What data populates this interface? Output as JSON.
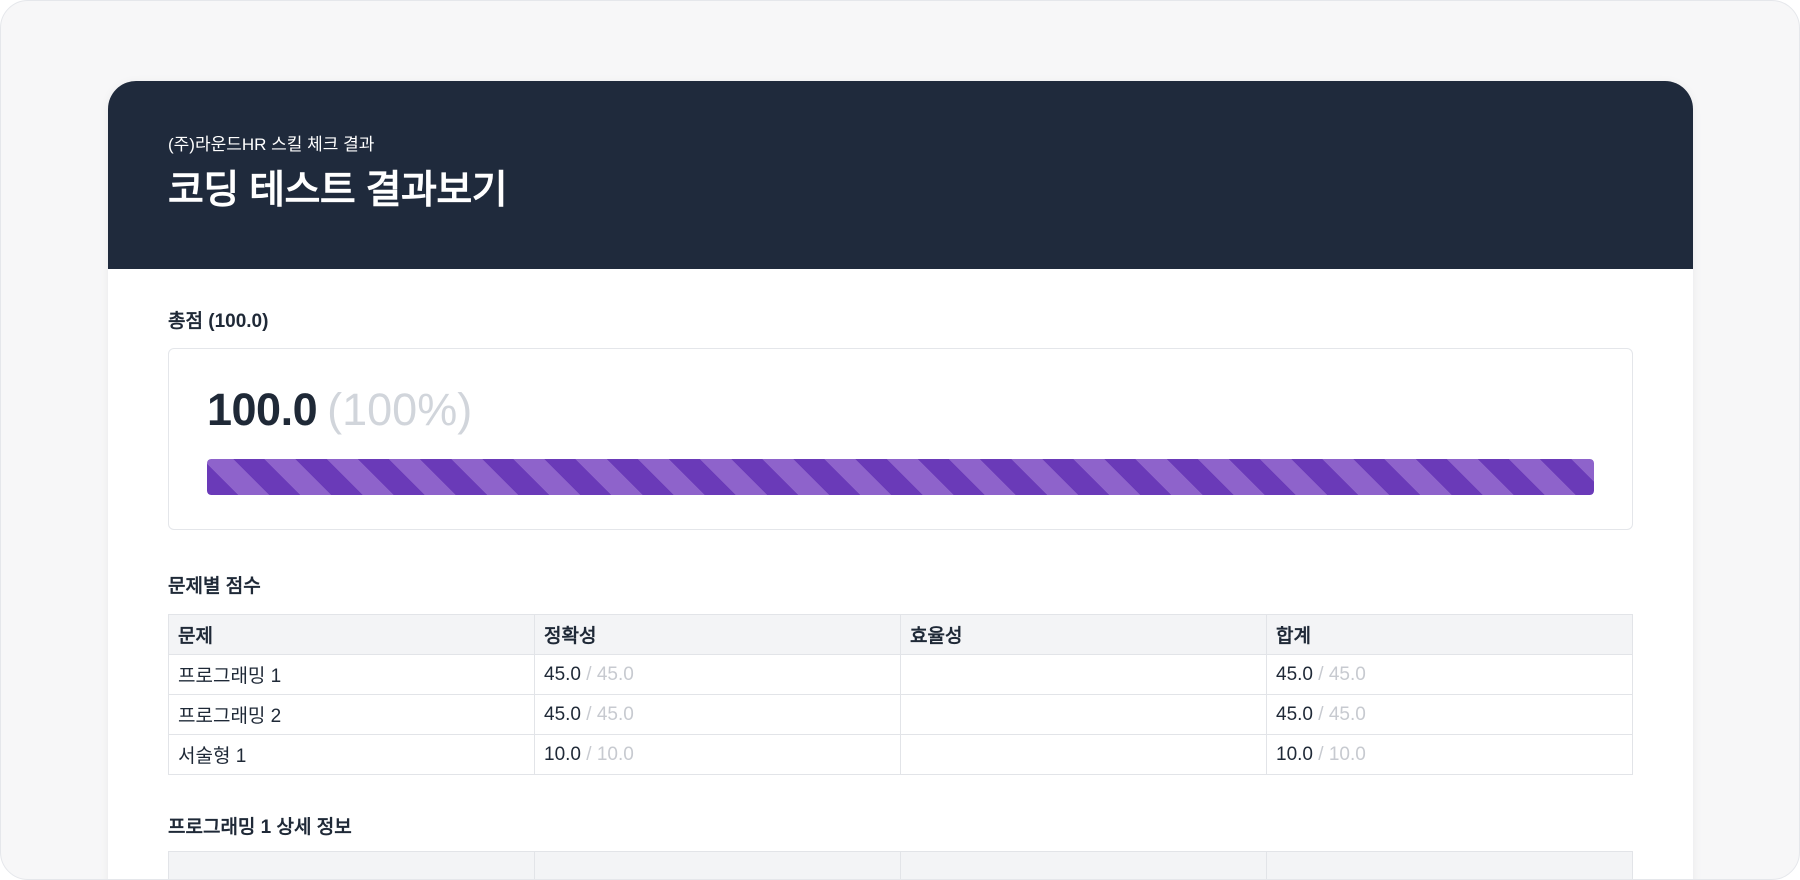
{
  "header": {
    "subtitle": "(주)라운드HR 스킬 체크 결과",
    "title": "코딩 테스트 결과보기"
  },
  "total": {
    "label": "총점 (100.0)",
    "score": "100.0",
    "percent_text": "(100%)",
    "progress_fraction": 1.0,
    "bar_colors": [
      "#6a3ab8",
      "#8e63cb"
    ]
  },
  "per_problem": {
    "label": "문제별 점수",
    "columns": [
      "문제",
      "정확성",
      "효율성",
      "합계"
    ],
    "rows": [
      {
        "problem": "프로그래밍 1",
        "accuracy": "45.0",
        "accuracy_max": "/ 45.0",
        "efficiency": "",
        "efficiency_max": "",
        "total": "45.0",
        "total_max": "/ 45.0"
      },
      {
        "problem": "프로그래밍 2",
        "accuracy": "45.0",
        "accuracy_max": "/ 45.0",
        "efficiency": "",
        "efficiency_max": "",
        "total": "45.0",
        "total_max": "/ 45.0"
      },
      {
        "problem": "서술형 1",
        "accuracy": "10.0",
        "accuracy_max": "/ 10.0",
        "efficiency": "",
        "efficiency_max": "",
        "total": "10.0",
        "total_max": "/ 10.0"
      }
    ]
  },
  "detail": {
    "label": "프로그래밍 1 상세 정보"
  }
}
